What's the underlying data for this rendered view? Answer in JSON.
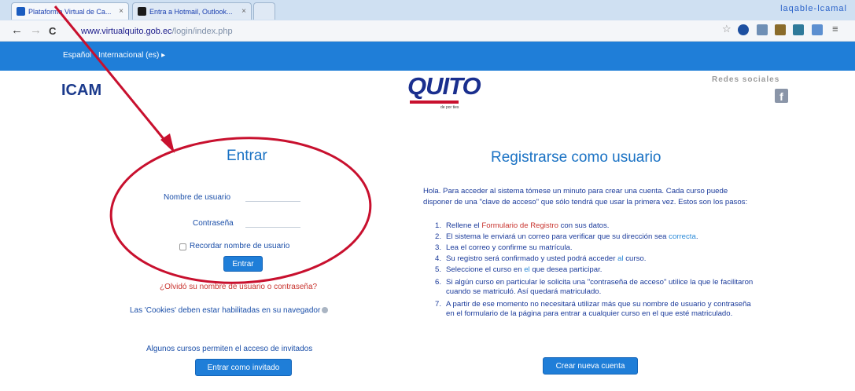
{
  "browser": {
    "tabs": [
      {
        "title": "Plataforma Virtual de Ca...",
        "close": "×"
      },
      {
        "title": "Entra a Hotmail, Outlook...",
        "close": "×"
      }
    ],
    "window_title": "laqable-lcamal",
    "url_host": "www.virtualquito.gob.ec",
    "url_path": "/login/index.php",
    "back": "←",
    "forward": "→",
    "reload": "C"
  },
  "topbar": {
    "language": "Español - Internacional (es) ▸"
  },
  "header": {
    "site_name": "ICAM",
    "logo_text": "QUITO",
    "logo_tagline": "de por ties",
    "social_label": "Redes sociales",
    "facebook": "f"
  },
  "login": {
    "title": "Entrar",
    "username_label": "Nombre de usuario",
    "password_label": "Contraseña",
    "remember_label": "Recordar nombre de usuario",
    "submit_label": "Entrar",
    "forgot_link": "¿Olvidó su nombre de usuario o contraseña?",
    "cookies_text": "Las 'Cookies' deben estar habilitadas en su navegador",
    "guest_text": "Algunos cursos permiten el acceso de invitados",
    "guest_button": "Entrar como invitado"
  },
  "register": {
    "title": "Registrarse como usuario",
    "intro": "Hola. Para acceder al sistema tómese un minuto para crear una cuenta. Cada curso puede disponer de una \"clave de acceso\" que sólo tendrá que usar la primera vez. Estos son los pasos:",
    "steps": [
      {
        "n": "1.",
        "a": "Rellene el ",
        "b": "Formulario de Registro",
        "c": " con sus datos."
      },
      {
        "n": "2.",
        "a": "El sistema le enviará un correo para verificar que su dirección sea ",
        "b": "correcta",
        "c": "."
      },
      {
        "n": "3.",
        "a": "Lea el correo y confirme su matrícula.",
        "b": "",
        "c": ""
      },
      {
        "n": "4.",
        "a": "Su registro será confirmado y usted podrá acceder ",
        "b": "al",
        "c": " curso."
      },
      {
        "n": "5.",
        "a": "Seleccione el curso en ",
        "b": "el",
        "c": " que desea participar."
      },
      {
        "n": "6.",
        "a": "Si algún curso en particular le solicita una \"contraseña de acceso\" utilice la que le facilitaron cuando se matriculó. Así quedará matriculado.",
        "b": "",
        "c": ""
      },
      {
        "n": "7.",
        "a": "A partir de ese momento no necesitará utilizar más que su nombre de usuario y contraseña en el formulario de la página para entrar a cualquier curso en el que esté matriculado.",
        "b": "",
        "c": ""
      }
    ],
    "create_button": "Crear nueva cuenta"
  },
  "colors": {
    "accent": "#1f7ed8",
    "annotation": "#c8102e",
    "title_blue": "#1a72c4",
    "link_red": "#c8332e"
  }
}
